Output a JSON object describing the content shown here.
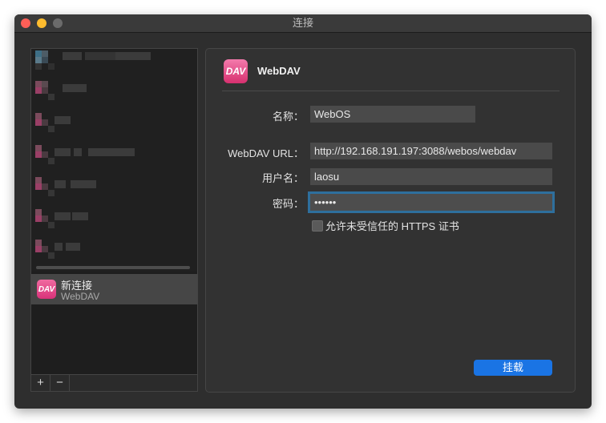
{
  "window": {
    "title": "连接"
  },
  "sidebar": {
    "selected_item": {
      "name": "新连接",
      "type": "WebDAV",
      "icon": "dav-icon"
    },
    "add_label": "+",
    "remove_label": "−"
  },
  "form": {
    "header_title": "WebDAV",
    "header_icon": "dav-icon",
    "name_label": "名称：",
    "name_value": "WebOS",
    "url_label": "WebDAV URL：",
    "url_value": "http://192.168.191.197:3088/webos/webdav",
    "user_label": "用户名：",
    "user_value": "laosu",
    "password_label": "密码：",
    "password_value": "laosu1",
    "https_checkbox_label": "允许未受信任的 HTTPS 证书",
    "https_checked": false,
    "mount_button": "挂载"
  },
  "colors": {
    "accent": "#1a74e4",
    "focus_ring": "#2e6f9d",
    "dav_pink": "#e0407f"
  }
}
